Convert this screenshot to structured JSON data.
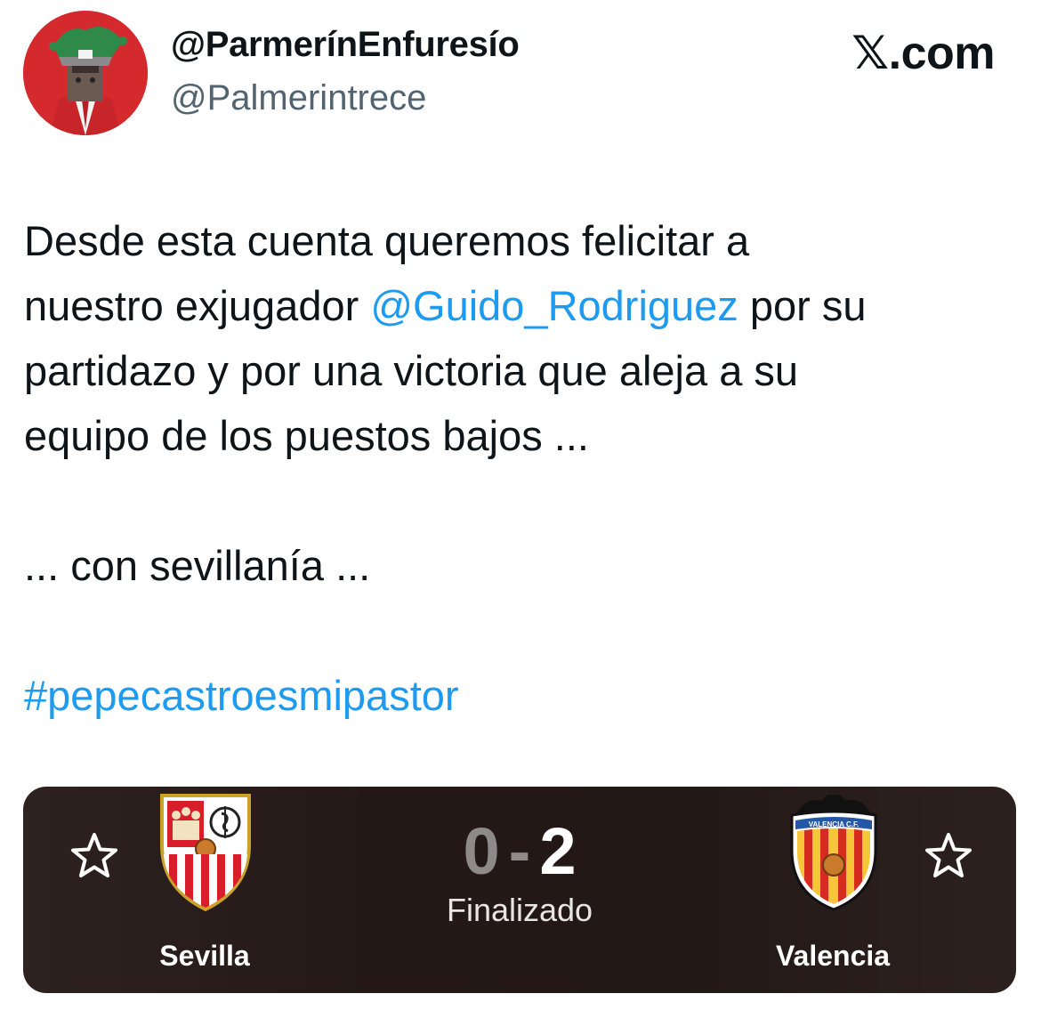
{
  "author": {
    "display_name": "@ParmerínEnfuresío",
    "handle": "@Palmerintrece",
    "avatar_icon": "profile-avatar-icon"
  },
  "brand": {
    "label": "𝕏.com"
  },
  "tweet": {
    "line1": "Desde esta cuenta queremos felicitar a",
    "line2_prefix": "nuestro exjugador ",
    "mention": "@Guido_Rodriguez",
    "line2_suffix": " por su",
    "line3": "partidazo y por una victoria que aleja a su",
    "line4": "equipo de los puestos bajos ...",
    "line5": "... con sevillanía ...",
    "hashtag": "#pepecastroesmipastor"
  },
  "match": {
    "home_team": "Sevilla",
    "away_team": "Valencia",
    "home_score": "0",
    "separator": "-",
    "away_score": "2",
    "status": "Finalizado",
    "home_crest_icon": "sevilla-crest-icon",
    "away_crest_icon": "valencia-crest-icon",
    "crest_text_valencia": "VALENCIA C.F.",
    "crest_text_sevilla": "S F"
  },
  "colors": {
    "link": "#1d9bf0",
    "text": "#0f1419",
    "handle": "#536471",
    "card_bg": "#241917"
  }
}
